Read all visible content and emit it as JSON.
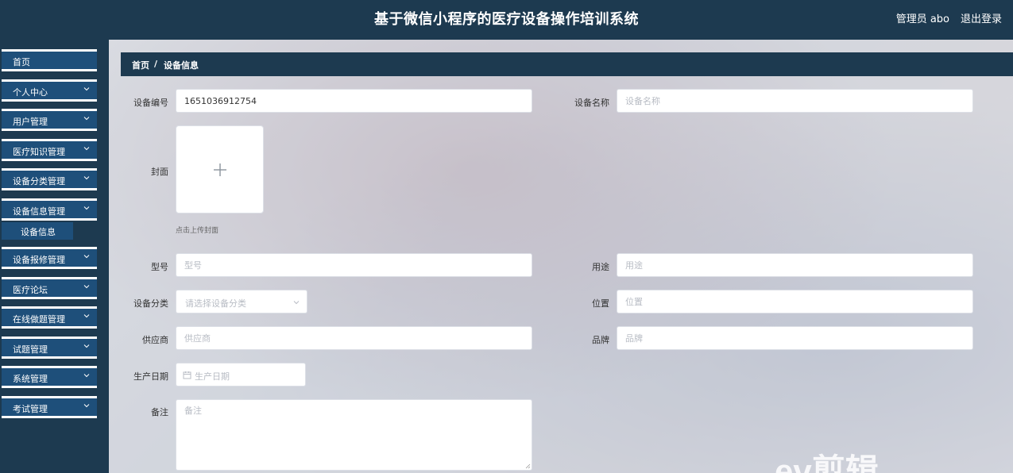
{
  "header": {
    "title": "基于微信小程序的医疗设备操作培训系统",
    "user": "管理员 abo",
    "logout": "退出登录"
  },
  "sidebar": {
    "items": [
      {
        "label": "首页",
        "has_arrow": false
      },
      {
        "label": "个人中心",
        "has_arrow": true
      },
      {
        "label": "用户管理",
        "has_arrow": true
      },
      {
        "label": "医疗知识管理",
        "has_arrow": true
      },
      {
        "label": "设备分类管理",
        "has_arrow": true
      },
      {
        "label": "设备信息管理",
        "has_arrow": true,
        "expanded": true,
        "children": [
          {
            "label": "设备信息"
          }
        ]
      },
      {
        "label": "设备报修管理",
        "has_arrow": true
      },
      {
        "label": "医疗论坛",
        "has_arrow": true
      },
      {
        "label": "在线做题管理",
        "has_arrow": true
      },
      {
        "label": "试题管理",
        "has_arrow": true
      },
      {
        "label": "系统管理",
        "has_arrow": true
      },
      {
        "label": "考试管理",
        "has_arrow": true
      }
    ]
  },
  "breadcrumb": {
    "home": "首页",
    "separator": "/",
    "current": "设备信息"
  },
  "form": {
    "device_no": {
      "label": "设备编号",
      "value": "1651036912754"
    },
    "device_name": {
      "label": "设备名称",
      "placeholder": "设备名称"
    },
    "cover": {
      "label": "封面",
      "tip": "点击上传封面"
    },
    "model": {
      "label": "型号",
      "placeholder": "型号"
    },
    "usage": {
      "label": "用途",
      "placeholder": "用途"
    },
    "category": {
      "label": "设备分类",
      "placeholder": "请选择设备分类"
    },
    "location": {
      "label": "位置",
      "placeholder": "位置"
    },
    "supplier": {
      "label": "供应商",
      "placeholder": "供应商"
    },
    "brand": {
      "label": "品牌",
      "placeholder": "品牌"
    },
    "production_date": {
      "label": "生产日期",
      "placeholder": "生产日期"
    },
    "remark": {
      "label": "备注",
      "placeholder": "备注"
    }
  },
  "watermark": "ev剪辑",
  "colors": {
    "nav_bg": "#1d3a50",
    "menu_item_bg": "#1e4f7a",
    "text_light": "#ffffff"
  }
}
